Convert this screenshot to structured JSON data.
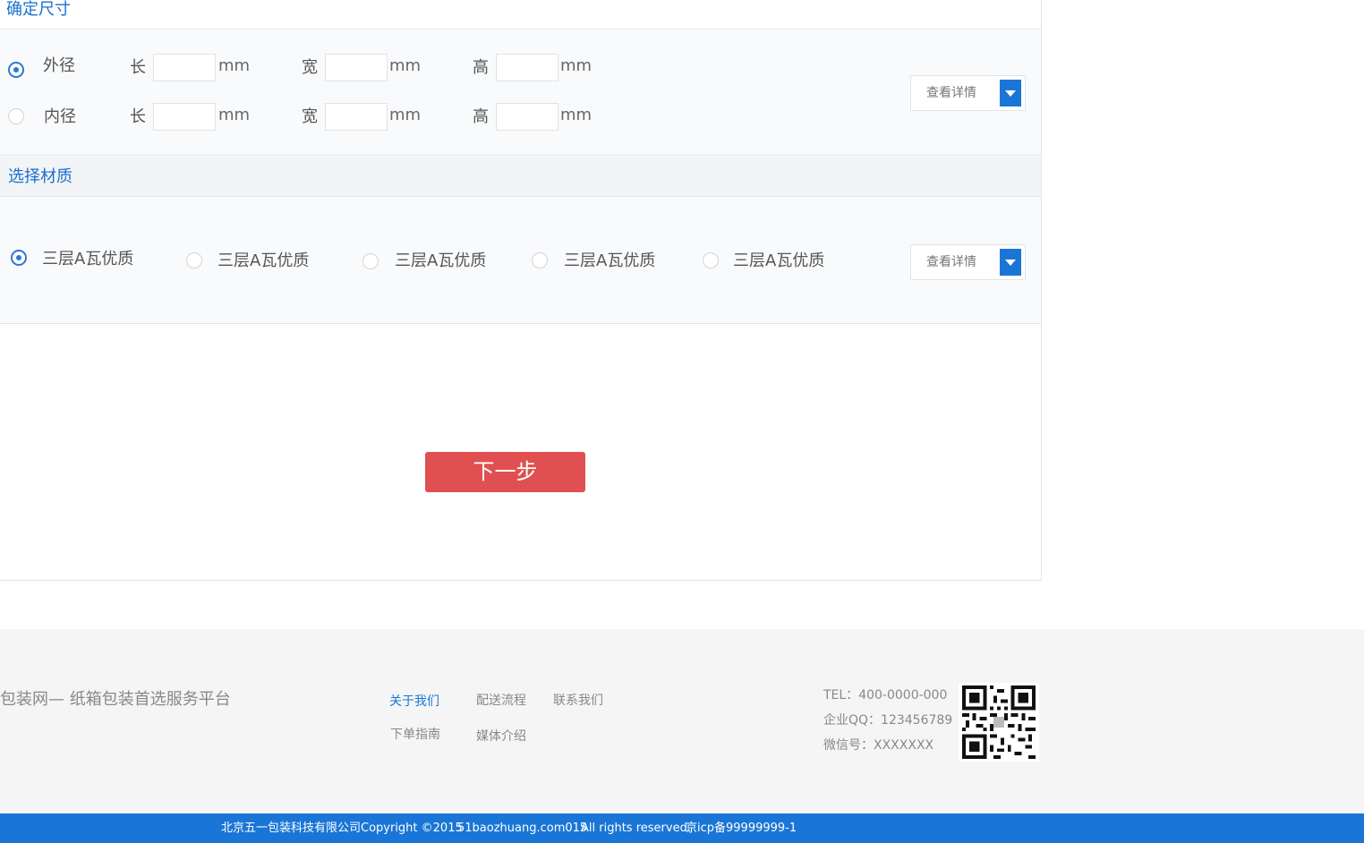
{
  "size_section": {
    "title": "确定尺寸",
    "rows": [
      {
        "label": "外径",
        "selected": true,
        "length_label": "长",
        "width_label": "宽",
        "height_label": "高",
        "unit": "mm"
      },
      {
        "label": "内径",
        "selected": false,
        "length_label": "长",
        "width_label": "宽",
        "height_label": "高",
        "unit": "mm"
      }
    ],
    "detail_label": "查看详情"
  },
  "material_section": {
    "title": "选择材质",
    "options": [
      {
        "label": "三层A瓦优质",
        "selected": true
      },
      {
        "label": "三层A瓦优质",
        "selected": false
      },
      {
        "label": "三层A瓦优质",
        "selected": false
      },
      {
        "label": "三层A瓦优质",
        "selected": false
      },
      {
        "label": "三层A瓦优质",
        "selected": false
      }
    ],
    "detail_label": "查看详情"
  },
  "next_button": "下一步",
  "footer": {
    "slogan": "包装网— 纸箱包装首选服务平台",
    "links": [
      "关于我们",
      "配送流程",
      "联系我们",
      "下单指南",
      "媒体介绍"
    ],
    "active_link": "关于我们",
    "tel": "TEL：400-0000-000",
    "qq": "企业QQ：123456789",
    "wechat": "微信号：XXXXXXX"
  },
  "bottom_bar": {
    "copyright": "北京五一包装科技有限公司Copyright ©2015",
    "site": "51baozhuang.com015",
    "rights": "All rights reserved.",
    "icp": "京icp备99999999-1"
  },
  "colors": {
    "accent": "#1a76d6",
    "next_button": "#e05050",
    "footer_bg": "#f5f5f5"
  },
  "icons": [
    "radio-selected-icon",
    "radio-unselected-icon",
    "dropdown-arrow-icon",
    "qr-code-icon"
  ]
}
